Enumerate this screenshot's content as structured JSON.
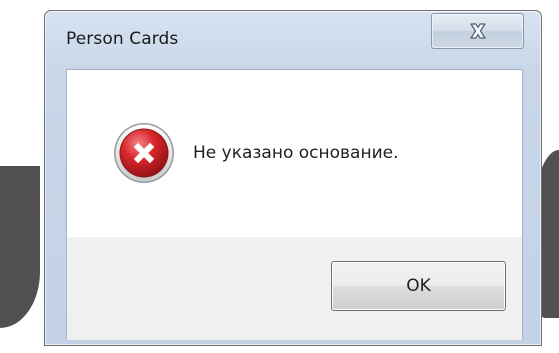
{
  "window": {
    "title": "Person Cards",
    "close_icon": "close-icon"
  },
  "message": {
    "icon": "error-icon",
    "text": "Не указано основание."
  },
  "buttons": {
    "ok_label": "OK"
  },
  "colors": {
    "frame": "#c8d6e8",
    "error_red": "#d8262b",
    "button_face": "#e6e6e6",
    "button_area": "#f0f0f0",
    "background_glyph": "#515151"
  }
}
